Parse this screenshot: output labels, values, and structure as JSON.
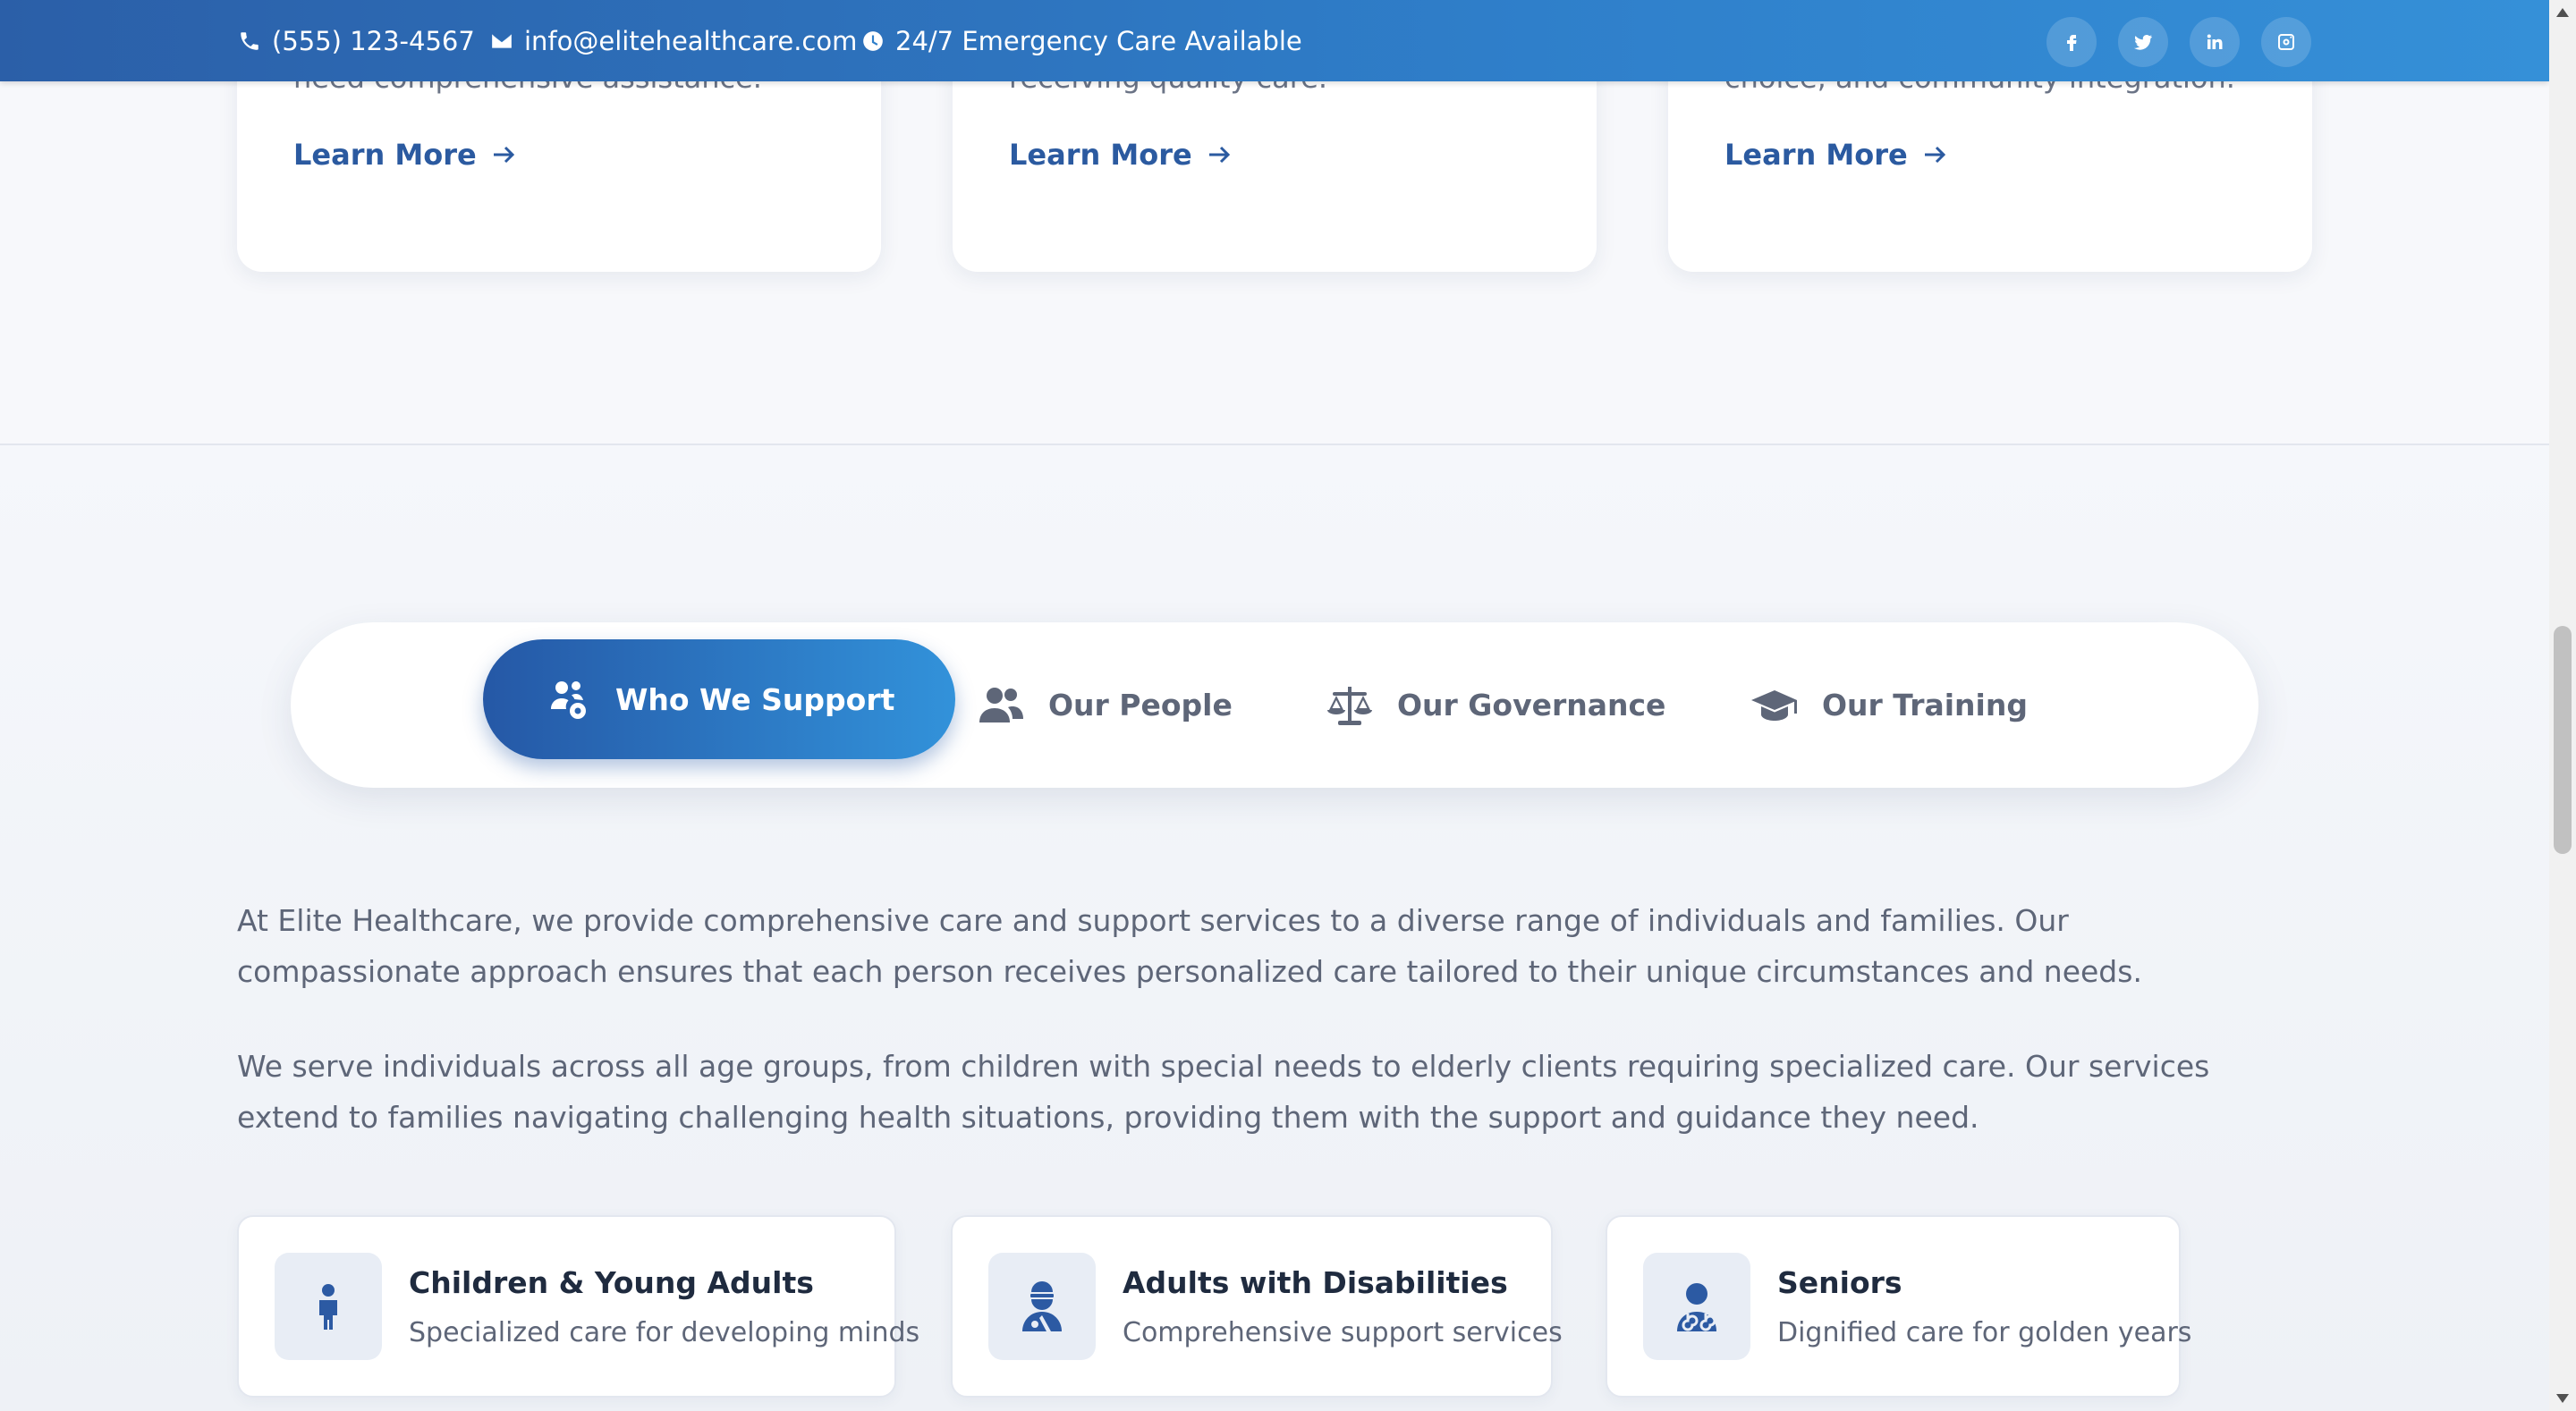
{
  "topbar": {
    "phone": "(555) 123-4567",
    "email": "info@elitehealthcare.com",
    "emergency": "24/7 Emergency Care Available",
    "socials": [
      "facebook-icon",
      "twitter-icon",
      "linkedin-icon",
      "instagram-icon"
    ]
  },
  "services": [
    {
      "text": "need comprehensive assistance.",
      "link": "Learn More"
    },
    {
      "text": "receiving quality care.",
      "link": "Learn More"
    },
    {
      "text": "choice, and community integration.",
      "link": "Learn More"
    }
  ],
  "tabs": [
    {
      "label": "Who We Support",
      "icon": "users-cog-icon",
      "active": true
    },
    {
      "label": "Our People",
      "icon": "users-icon",
      "active": false
    },
    {
      "label": "Our Governance",
      "icon": "balance-scale-icon",
      "active": false
    },
    {
      "label": "Our Training",
      "icon": "graduation-cap-icon",
      "active": false
    }
  ],
  "content": {
    "paragraph1": "At Elite Healthcare, we provide comprehensive care and support services to a diverse range of individuals and families. Our compassionate approach ensures that each person receives personalized care tailored to their unique circumstances and needs.",
    "paragraph2": "We serve individuals across all age groups, from children with special needs to elderly clients requiring specialized care. Our services extend to families navigating challenging health situations, providing them with the support and guidance they need."
  },
  "support_cards": [
    {
      "title": "Children & Young Adults",
      "subtitle": "Specialized care for developing minds",
      "icon": "child-icon"
    },
    {
      "title": "Adults with Disabilities",
      "subtitle": "Comprehensive support services",
      "icon": "user-injured-icon"
    },
    {
      "title": "Seniors",
      "subtitle": "Dignified care for golden years",
      "icon": "user-doctor-icon"
    }
  ],
  "colors": {
    "brand_primary": "#2b5fa8",
    "brand_accent": "#3590d8",
    "link": "#2b5aa0",
    "heading": "#1f2b3f",
    "body_text": "#5e6678"
  }
}
